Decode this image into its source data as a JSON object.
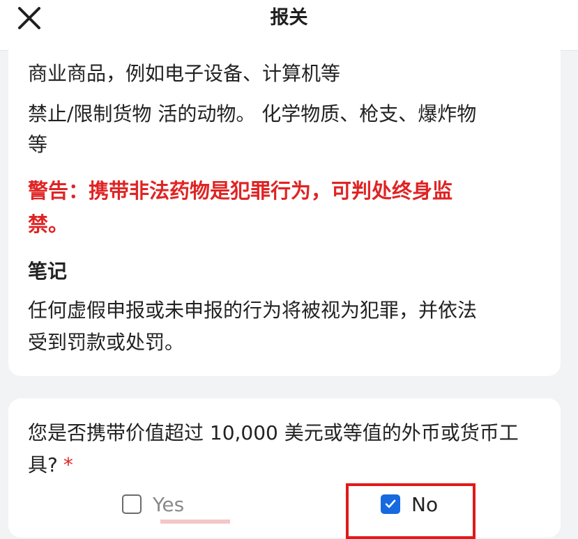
{
  "header": {
    "title": "报关",
    "close_icon": "close-icon"
  },
  "info_card": {
    "commercial_goods": "商业商品，例如电子设备、计算机等",
    "prohibited_line1": "禁止/限制货物 活的动物。 化学物质、枪支、爆炸物",
    "prohibited_line2": "等",
    "warning_line1": "警告：携带非法药物是犯罪行为，可判处终身监",
    "warning_line2": "禁。",
    "notes_title": "笔记",
    "notes_line1": "任何虚假申报或未申报的行为将被视为犯罪，并依法",
    "notes_line2": "受到罚款或处罚。"
  },
  "question_card": {
    "question_line1": "您是否携带价值超过 10,000 美元或等值的外币或货币工",
    "question_line2": "具?",
    "required_mark": "*",
    "options": [
      {
        "label": "Yes",
        "checked": false
      },
      {
        "label": "No",
        "checked": true
      }
    ]
  },
  "colors": {
    "warning_red": "#e02424",
    "check_blue": "#1769e0",
    "highlight_red": "#e01a1a"
  }
}
